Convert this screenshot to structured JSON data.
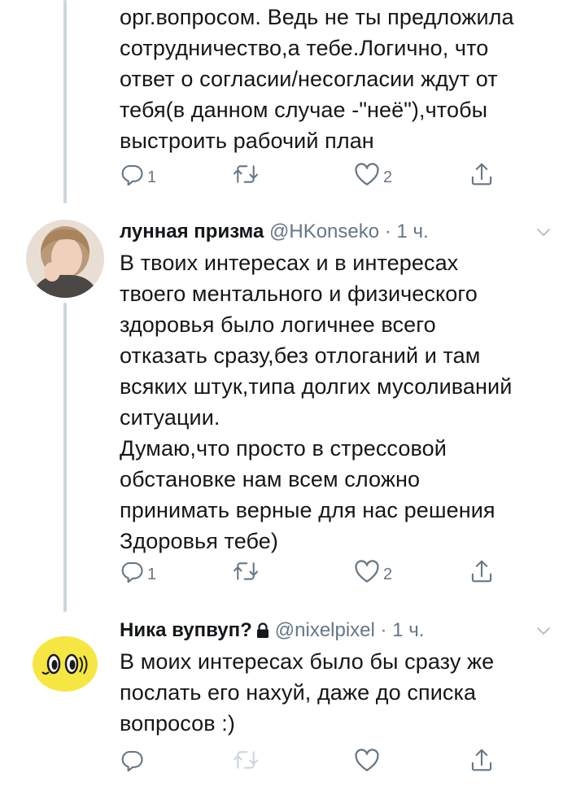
{
  "tweets": [
    {
      "text": "орг.вопросом. Ведь не ты предложила\nсотрудничество,а тебе.Логично, что\nответ о согласии/несогласии ждут от\nтебя(в данном случае -\"неё\"),чтобы\nвыстроить рабочий план",
      "reply_count": "1",
      "like_count": "2"
    },
    {
      "name": "лунная призма",
      "handle": "@HKonseko",
      "dot": "·",
      "time": "1 ч.",
      "text": "В твоих интересах и в интересах\nтвоего ментального и физического\nздоровья было логичнее всего\nотказать сразу,без отлоганий и там\nвсяких штук,типа долгих мусоливаний\nситуации.\nДумаю,что просто в стрессовой\nобстановке нам всем сложно\nпринимать верные для нас решения\nЗдоровья тебе)",
      "reply_count": "1",
      "like_count": "2"
    },
    {
      "name": "Ника вупвуп?",
      "handle": "@nixelpixel",
      "dot": "·",
      "time": "1 ч.",
      "text": "В моих интересах было бы сразу же\nпослать его нахуй, даже до списка\nвопросов :)",
      "reply_count": "",
      "like_count": ""
    }
  ],
  "icons": {
    "reply": "reply-icon",
    "retweet": "retweet-icon",
    "like": "heart-icon",
    "share": "share-icon",
    "caret": "chevron-down-icon",
    "lock": "lock-icon"
  },
  "colors": {
    "text": "#14171a",
    "secondary": "#657786",
    "thread_line": "#ccd6dd",
    "divider": "#e6ecf0",
    "retweet_disabled": "#ccd6dd",
    "avatar_yellow": "#f5e642"
  }
}
